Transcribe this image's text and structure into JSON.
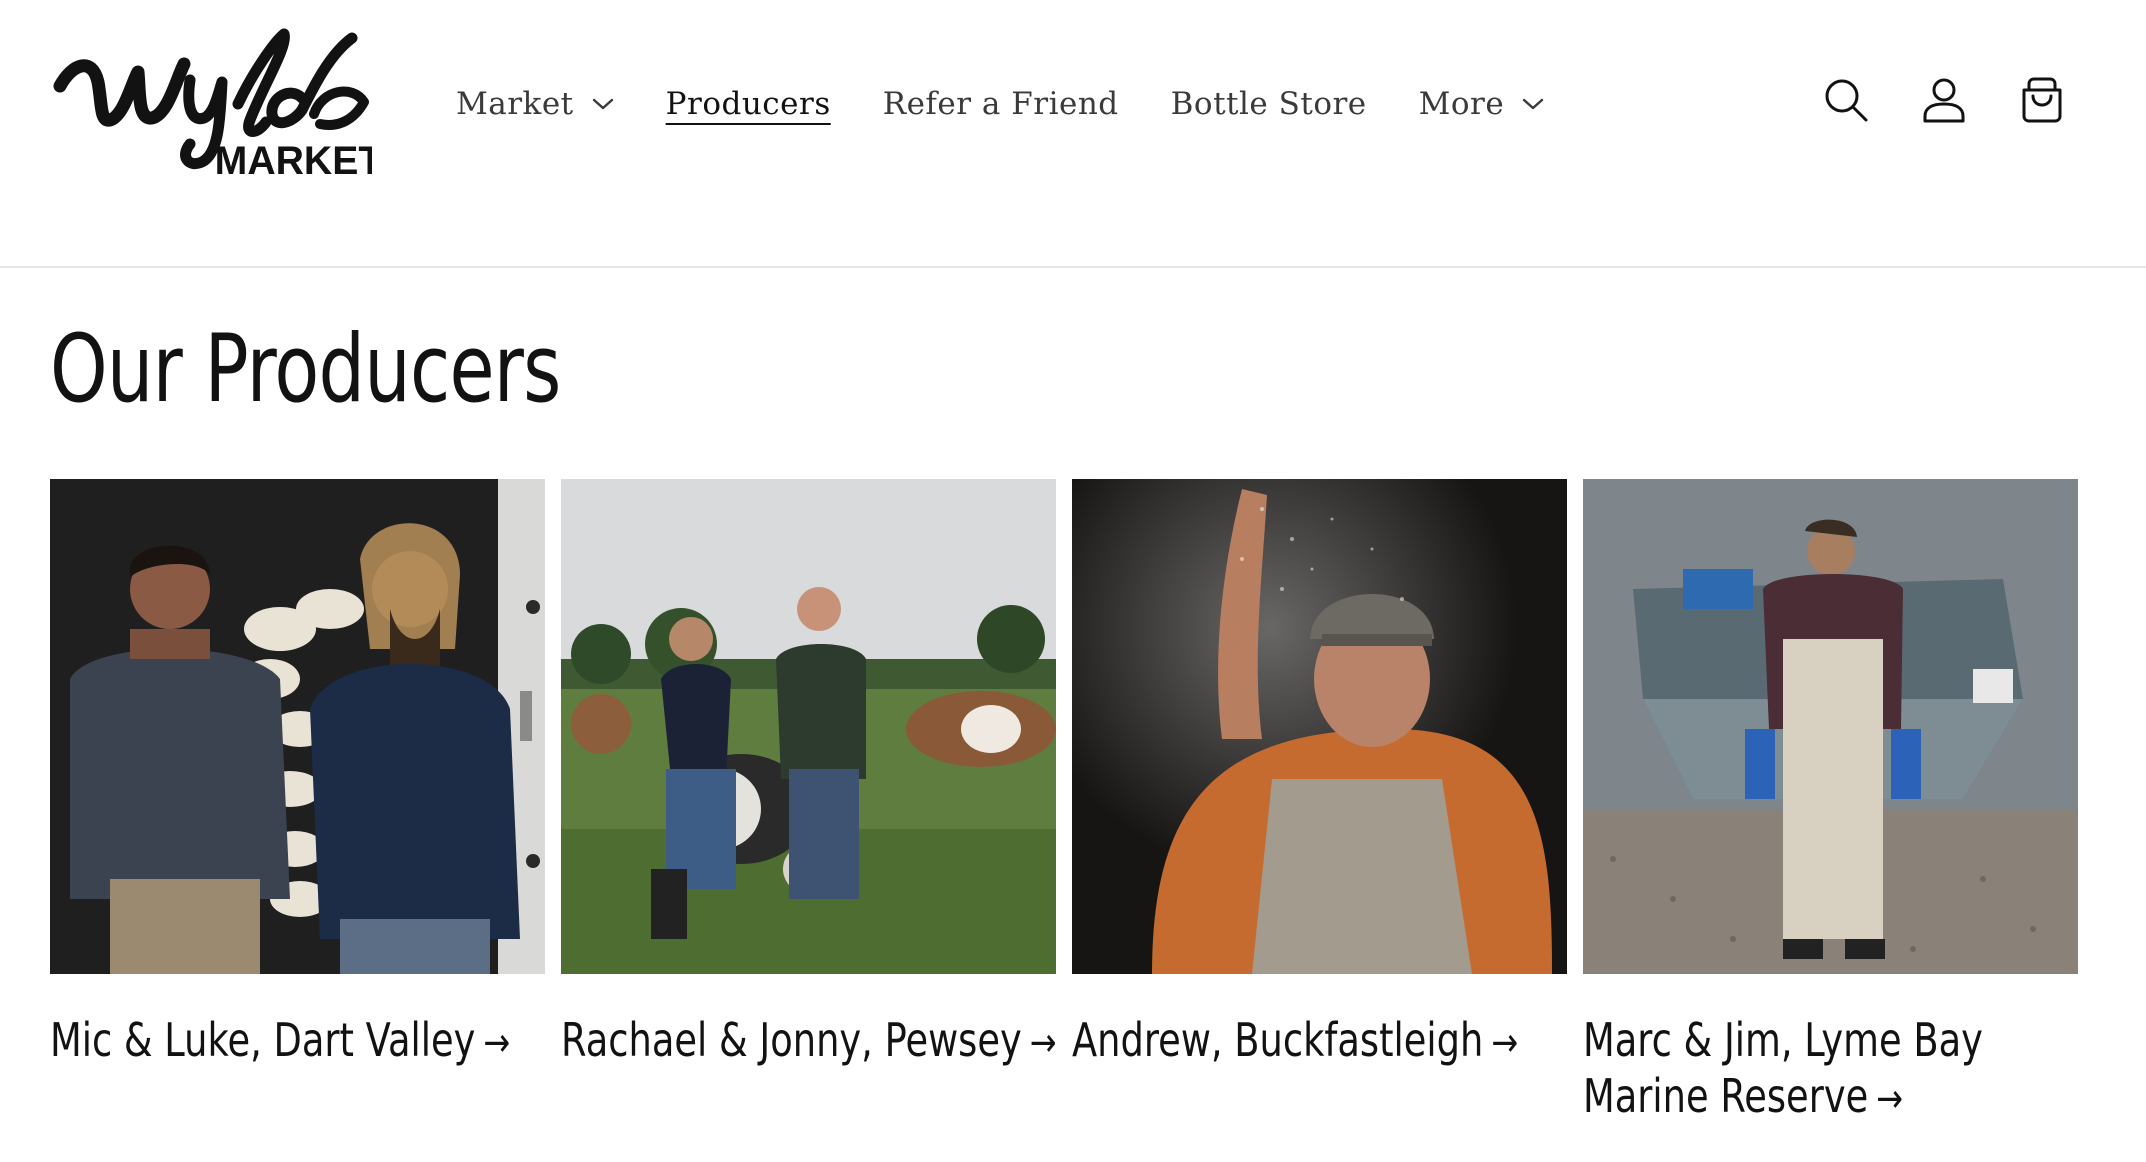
{
  "brand": {
    "logo_script": "Wylde",
    "logo_word": "MARKET"
  },
  "nav": {
    "items": [
      {
        "label": "Market",
        "has_dropdown": true,
        "active": false
      },
      {
        "label": "Producers",
        "has_dropdown": false,
        "active": true
      },
      {
        "label": "Refer a Friend",
        "has_dropdown": false,
        "active": false
      },
      {
        "label": "Bottle Store",
        "has_dropdown": false,
        "active": false
      },
      {
        "label": "More",
        "has_dropdown": true,
        "active": false
      }
    ]
  },
  "header_icons": [
    "search-icon",
    "account-icon",
    "cart-icon"
  ],
  "page": {
    "title": "Our Producers"
  },
  "producers": [
    {
      "name": "Mic & Luke, Dart Valley",
      "arrow": "→"
    },
    {
      "name": "Rachael & Jonny, Pewsey",
      "arrow": "→"
    },
    {
      "name": "Andrew, Buckfastleigh",
      "arrow": "→"
    },
    {
      "name": "Marc & Jim, Lyme Bay Marine Reserve",
      "arrow": "→"
    }
  ],
  "colors": {
    "text": "#121212",
    "nav_text": "#3a3a3a",
    "divider": "#e6e6e6",
    "background": "#ffffff"
  }
}
